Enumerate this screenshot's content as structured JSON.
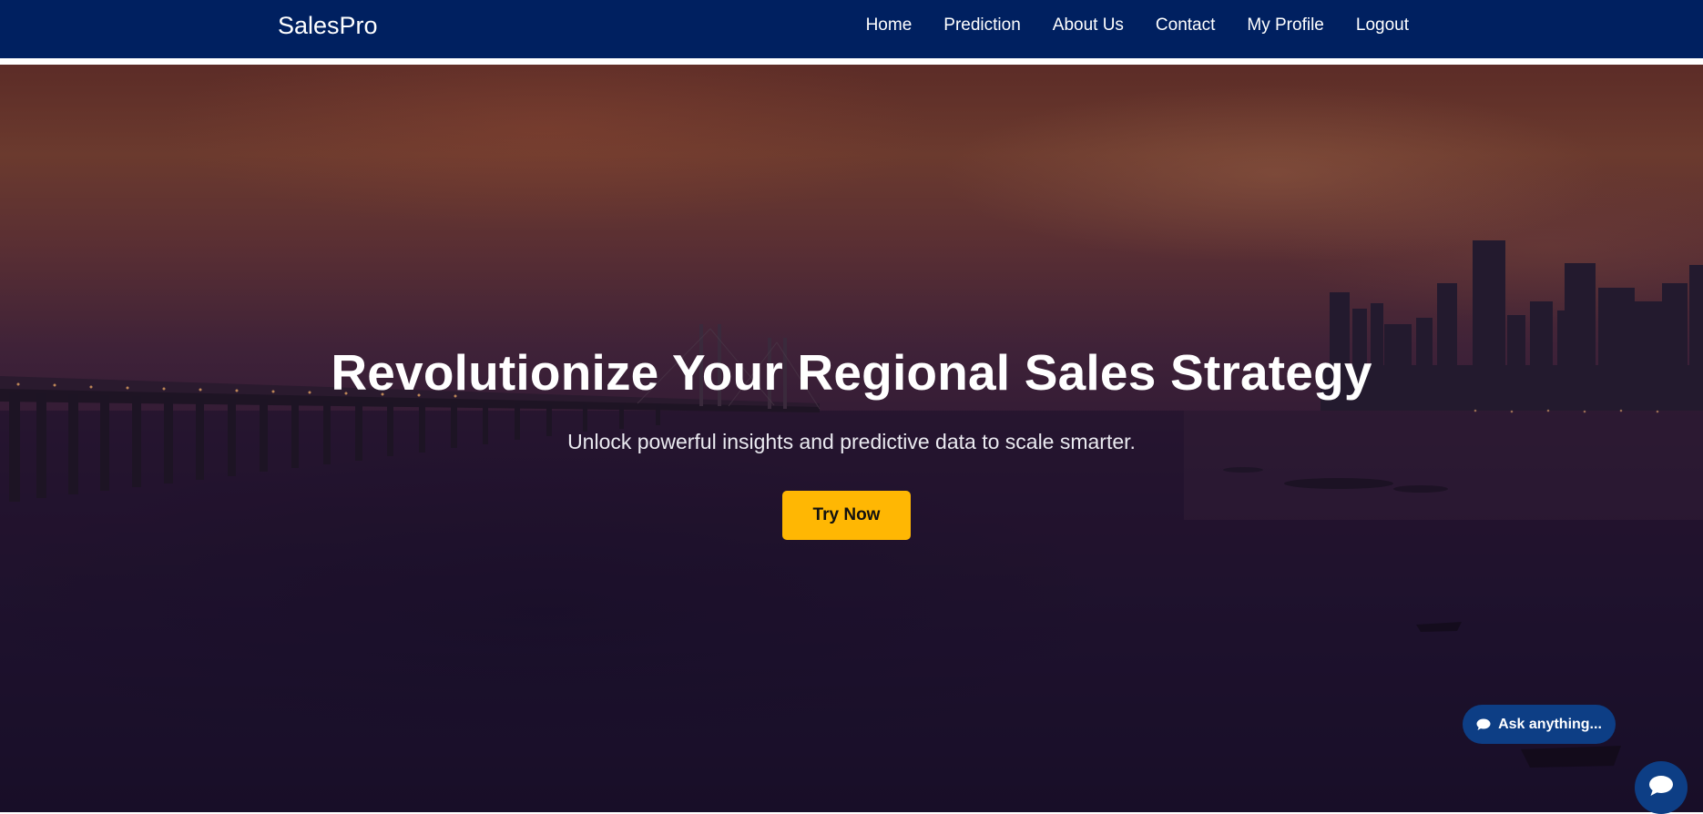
{
  "navbar": {
    "brand": "SalesPro",
    "links": [
      {
        "label": "Home"
      },
      {
        "label": "Prediction"
      },
      {
        "label": "About Us"
      },
      {
        "label": "Contact"
      },
      {
        "label": "My Profile"
      },
      {
        "label": "Logout"
      }
    ],
    "background_color": "#002060"
  },
  "hero": {
    "title": "Revolutionize Your Regional Sales Strategy",
    "subtitle": "Unlock powerful insights and predictive data to scale smarter.",
    "cta_label": "Try Now",
    "cta_color": "#ffb703"
  },
  "chat": {
    "ask_label": "Ask anything...",
    "ask_icon": "speech-bubble-icon",
    "fab_icon": "chat-bubble-icon",
    "color": "#0d3e85"
  }
}
